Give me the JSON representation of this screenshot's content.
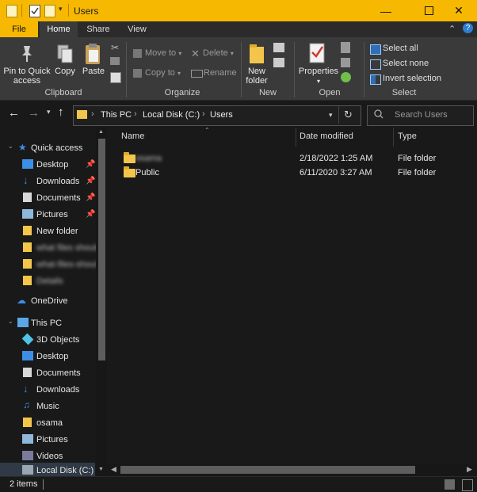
{
  "window": {
    "title": "Users",
    "accent": "#f6b800",
    "controls": [
      "minimize-icon",
      "maximize-icon",
      "close-icon"
    ]
  },
  "tabs": [
    {
      "label": "File"
    },
    {
      "label": "Home"
    },
    {
      "label": "Share"
    },
    {
      "label": "View"
    }
  ],
  "ribbon": {
    "clipboard": {
      "group_label": "Clipboard",
      "pin_label": "Pin to Quick access",
      "copy_label": "Copy",
      "paste_label": "Paste"
    },
    "organize": {
      "group_label": "Organize",
      "move_to": "Move to",
      "copy_to": "Copy to",
      "delete": "Delete",
      "rename": "Rename"
    },
    "new": {
      "group_label": "New",
      "new_folder": "New folder"
    },
    "open": {
      "group_label": "Open",
      "properties": "Properties"
    },
    "select": {
      "group_label": "Select",
      "select_all": "Select all",
      "select_none": "Select none",
      "invert_selection": "Invert selection"
    }
  },
  "address": {
    "crumbs": [
      "This PC",
      "Local Disk (C:)",
      "Users"
    ],
    "search_placeholder": "Search Users"
  },
  "nav": {
    "quick_access": "Quick access",
    "quick_items": [
      {
        "label": "Desktop"
      },
      {
        "label": "Downloads"
      },
      {
        "label": "Documents"
      },
      {
        "label": "Pictures"
      },
      {
        "label": "New folder"
      },
      {
        "label": "what files should"
      },
      {
        "label": "what-files-shoul"
      },
      {
        "label": "Details"
      }
    ],
    "onedrive": "OneDrive",
    "this_pc": "This PC",
    "pc_items": [
      {
        "label": "3D Objects"
      },
      {
        "label": "Desktop"
      },
      {
        "label": "Documents"
      },
      {
        "label": "Downloads"
      },
      {
        "label": "Music"
      },
      {
        "label": "osama"
      },
      {
        "label": "Pictures"
      },
      {
        "label": "Videos"
      },
      {
        "label": "Local Disk (C:)"
      }
    ]
  },
  "columns": {
    "name": "Name",
    "date": "Date modified",
    "type": "Type"
  },
  "files": [
    {
      "name": "osama",
      "date": "2/18/2022 1:25 AM",
      "type": "File folder"
    },
    {
      "name": "Public",
      "date": "6/11/2020 3:27 AM",
      "type": "File folder"
    }
  ],
  "status": {
    "count": "2 items"
  }
}
